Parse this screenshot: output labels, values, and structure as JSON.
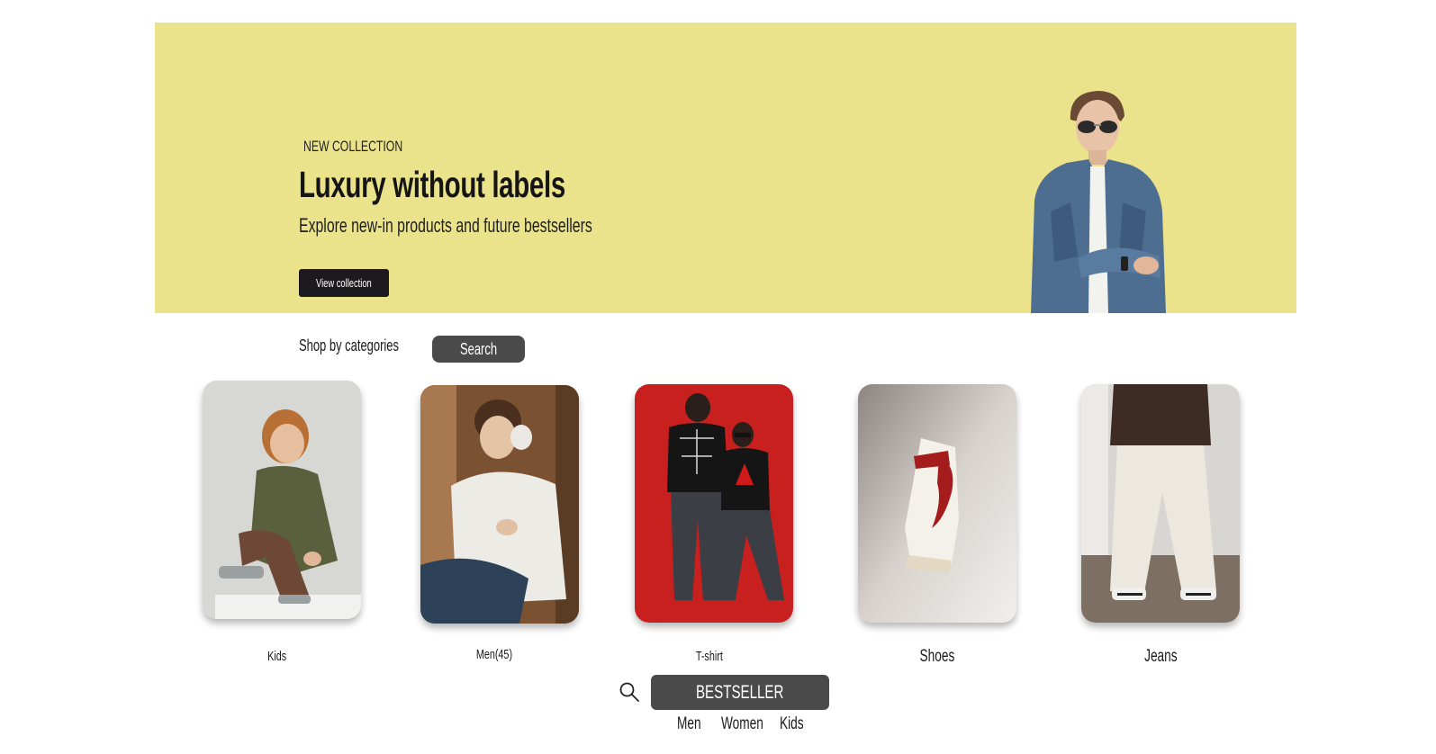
{
  "hero": {
    "eyebrow": "NEW COLLECTION",
    "title": "Luxury without labels",
    "subtitle": "Explore new-in products and future bestsellers",
    "cta": "View collection",
    "background": "#ebe38b"
  },
  "categories": {
    "heading": "Shop by categories",
    "search_label": "Search",
    "items": [
      {
        "label": "Kids",
        "image": "kid-in-olive-jacket-photo"
      },
      {
        "label": "Men(45)",
        "image": "teen-in-fleece-hoodie-photo"
      },
      {
        "label": "T-shirt",
        "image": "couple-in-spider-tees-photo"
      },
      {
        "label": "Shoes",
        "image": "white-red-sneaker-photo"
      },
      {
        "label": "Jeans",
        "image": "white-wide-jeans-photo"
      }
    ]
  },
  "bottom": {
    "search_icon": "search-icon",
    "bestseller_label": "BESTSELLER",
    "nav": [
      "Men",
      "Women",
      "Kids"
    ]
  }
}
